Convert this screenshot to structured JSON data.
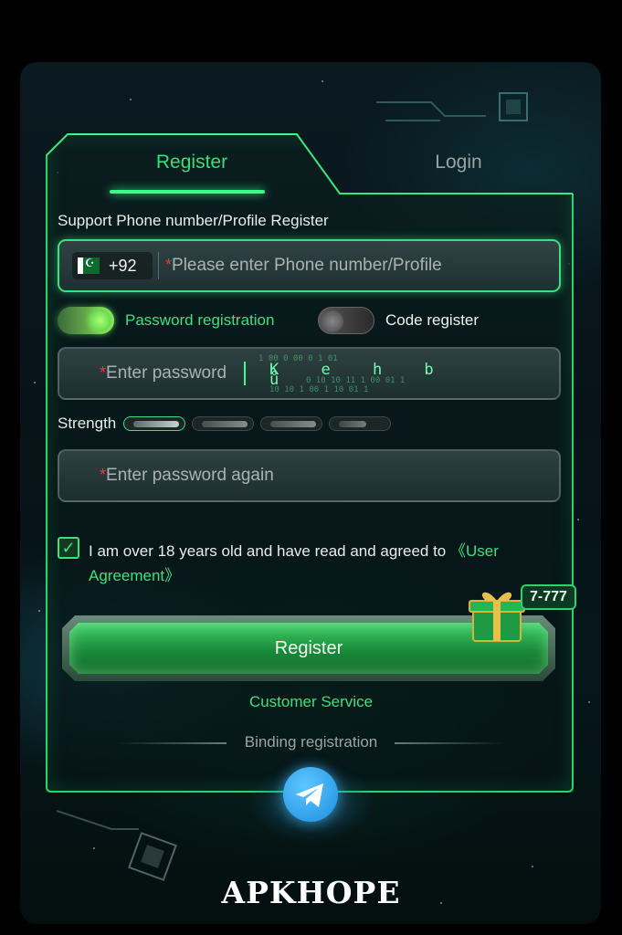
{
  "tabs": {
    "register": "Register",
    "login": "Login"
  },
  "form": {
    "support_label": "Support Phone number/Profile Register",
    "country_code": "+92",
    "required_mark": "*",
    "phone_placeholder": "Please enter Phone number/Profile",
    "password_placeholder": "Enter password",
    "password_again_placeholder": "Enter password again",
    "toggle_password": "Password registration",
    "toggle_code": "Code register",
    "strength_label": "Strength",
    "strength_level": 1,
    "strength_segments": 4,
    "agree_text": "I am over 18 years old and have read and agreed to ",
    "agree_link": "《User Agreement》",
    "agree_checked": true
  },
  "actions": {
    "register": "Register",
    "gift_badge": "7-777",
    "customer_service": "Customer Service",
    "binding": "Binding registration"
  },
  "icons": {
    "flag": "pakistan-flag-icon",
    "gift": "gift-box-icon",
    "social": "telegram-icon"
  },
  "watermark": "APKHOPE",
  "colors": {
    "accent": "#3ee07e",
    "required": "#e33b3b",
    "telegram": "#1c8fe0"
  }
}
